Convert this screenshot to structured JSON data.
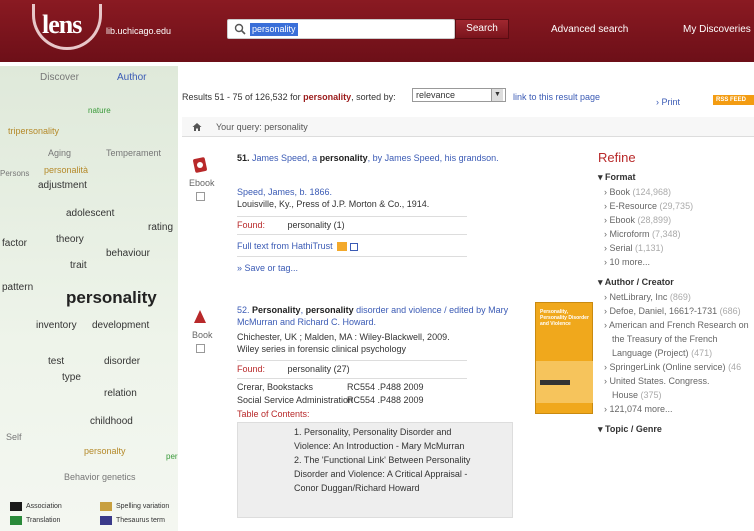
{
  "header": {
    "logo_text": "lens",
    "logo_domain": "lib.uchicago.edu",
    "search_value": "personality",
    "search_button": "Search",
    "advanced_search": "Advanced search",
    "my_discoveries": "My Discoveries"
  },
  "left_panel": {
    "tabs": [
      "Discover",
      "Author"
    ],
    "cloud": [
      "nature",
      "tripersonality",
      "Aging",
      "Temperament",
      "Persons",
      "personalità",
      "adjustment",
      "adolescent",
      "rating",
      "factor",
      "theory",
      "behaviour",
      "trait",
      "pattern",
      "personality",
      "inventory",
      "development",
      "test",
      "disorder",
      "type",
      "relation",
      "childhood",
      "Self",
      "personalty",
      "per",
      "Behavior genetics"
    ],
    "legend": [
      "Association",
      "Spelling variation",
      "Translation",
      "Thesaurus term"
    ],
    "legend_colors": [
      "#1a1a1a",
      "#c8a040",
      "#2a8a3a",
      "#3a3a8a"
    ]
  },
  "results": {
    "summary_prefix": "Results 51 - 75 of 126,532 for",
    "query_term": "personality",
    "sorted_by": ", sorted by:",
    "sort_value": "relevance",
    "link_text": "link to this result page",
    "print": "Print",
    "rss": "RSS FEED",
    "your_query": "Your query: personality"
  },
  "records": [
    {
      "number": "51.",
      "title_parts": [
        "James Speed, a ",
        "personality",
        ", by James Speed, his grandson."
      ],
      "format": "Ebook",
      "author": "Speed, James, b. 1866.",
      "publication": "Louisville, Ky., Press of J.P. Morton & Co., 1914.",
      "found_label": "Found:",
      "found_value": "personality (1)",
      "fulltext": "Full text from HathiTrust",
      "save": "» Save or tag..."
    },
    {
      "number": "52.",
      "title_parts": [
        "Personality",
        ", ",
        "personality",
        " disorder and violence / edited by Mary McMurran and Richard C. Howard."
      ],
      "format": "Book",
      "publication": "Chichester, UK ; Malden, MA : Wiley-Blackwell, 2009.",
      "series": "Wiley series in forensic clinical psychology",
      "found_label": "Found:",
      "found_value": "personality (27)",
      "holdings": [
        {
          "location": "Crerar, Bookstacks",
          "call": "RC554 .P488 2009"
        },
        {
          "location": "Social Service Administration",
          "call": "RC554 .P488 2009"
        }
      ],
      "toc_label": "Table of Contents:",
      "toc": [
        "1. Personality, Personality Disorder and",
        "Violence: An Introduction - Mary McMurran",
        "2. The 'Functional Link' Between Personality",
        "Disorder and Violence: A Critical Appraisal -",
        "Conor Duggan/Richard Howard"
      ],
      "cover_text": "Personality, Personality Disorder and Violence"
    }
  ],
  "refine": {
    "title": "Refine",
    "format_heading": "Format",
    "format_items": [
      {
        "label": "Book",
        "count": "(124,968)"
      },
      {
        "label": "E-Resource",
        "count": "(29,735)"
      },
      {
        "label": "Ebook",
        "count": "(28,899)"
      },
      {
        "label": "Microform",
        "count": "(7,348)"
      },
      {
        "label": "Serial",
        "count": "(1,131)"
      },
      {
        "label": "10 more...",
        "count": ""
      }
    ],
    "author_heading": "Author / Creator",
    "author_items": [
      {
        "label": "NetLibrary, Inc",
        "count": "(869)"
      },
      {
        "label": "Defoe, Daniel, 1661?-1731",
        "count": "(686)"
      },
      {
        "label": "American and French Research on",
        "count": ""
      },
      {
        "label": "the Treasury of the French",
        "count": ""
      },
      {
        "label": "Language (Project)",
        "count": "(471)"
      },
      {
        "label": "SpringerLink (Online service)",
        "count": "(46"
      },
      {
        "label": "United States. Congress.",
        "count": ""
      },
      {
        "label": "House",
        "count": "(375)"
      },
      {
        "label": "121,074 more...",
        "count": ""
      }
    ],
    "topic_heading": "Topic / Genre"
  }
}
